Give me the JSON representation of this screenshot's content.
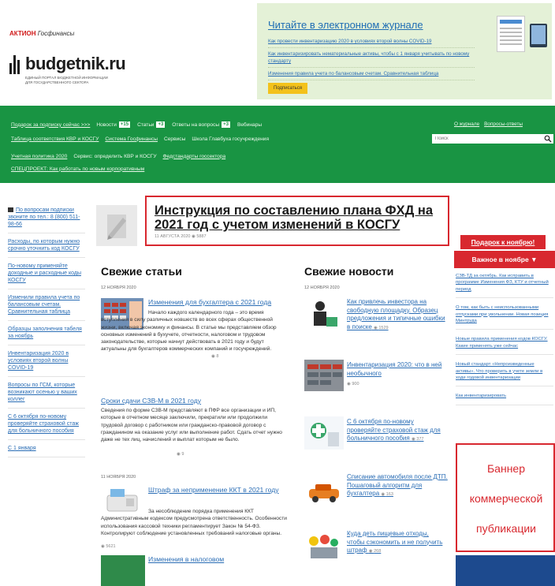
{
  "header": {
    "brand_logo": "АКТИОН",
    "brand_suffix": "Госфинансы",
    "site_name": "budgetnik.ru",
    "site_tagline": "Единый портал бюджетной информации для государственного сектора",
    "journal": {
      "title": "Читайте в электронном журнале",
      "items": [
        "Как провести инвентаризацию 2020 в условиях второй волны COVID-19",
        "Как инвентаризировать нематериальные активы, чтобы с 1 января учитывать по новому стандарту",
        "Изменения правила учета по балансовым счетам. Сравнительная таблица"
      ],
      "subscribe_label": "Подписаться"
    }
  },
  "nav": {
    "row1": [
      {
        "label": "Подарок за подписку сейчас >>>",
        "link": true
      },
      {
        "label": "Новости",
        "link": false,
        "badge": "+15"
      },
      {
        "label": "Статьи",
        "link": false,
        "badge": "+3"
      },
      {
        "label": "Ответы на вопросы",
        "link": false,
        "badge": "+3"
      },
      {
        "label": "Вебинары",
        "link": false
      }
    ],
    "row2": [
      {
        "label": "Таблица соответствия КВР и КОСГУ",
        "link": true
      },
      {
        "label": "Система Госфинансы",
        "link": true
      },
      {
        "label": "Сервисы",
        "link": false
      },
      {
        "label": "Школа Главбуха госучреждения",
        "link": false
      }
    ],
    "row3": [
      {
        "label": "Учетная политика 2020",
        "link": true
      },
      {
        "label": "Сервис: определить КВР и КОСГУ",
        "link": false
      },
      {
        "label": "Федстандарты госсектора",
        "link": true
      }
    ],
    "row4": [
      {
        "label": "СПЕЦПРОЕКТ: Как работать по новым корпоративным",
        "link": true
      }
    ],
    "right_links": [
      "О журнале",
      "Вопросы-ответы"
    ],
    "search_placeholder": "Поиск"
  },
  "left_sidebar": {
    "phone_block": "По вопросам подписки звоните по тел.: 8 (800) 511-98-66",
    "items": [
      "Расходы, по которым нужно срочно уточнить код КОСГУ",
      "По-новому применяйте доходные и расходные коды КОСГУ",
      "Изменили правила учета по балансовым счетам. Сравнительная таблица",
      "Образцы заполнения табеля за ноябрь",
      "Инвентаризация 2020 в условиях второй волны COVID-19",
      "Вопросы по ГСМ, которые возникают осенью у ваших коллег",
      "С 6 октября по-новому проверяйте страховой стаж для больничного пособия",
      "С 1 января"
    ]
  },
  "hero": {
    "title": "Инструкция по составлению плана ФХД на 2021 год с учетом изменений в КОСГУ",
    "date": "11 АВГУСТА 2020",
    "views": "5887"
  },
  "articles": {
    "heading": "Свежие статьи",
    "date1": "12 ноября 2020",
    "a1": {
      "title": "Изменения для бухгалтера с 2021 года",
      "text": "Начало каждого календарного года – это время вступления в силу различных новшеств во всех сферах общественной жизни, включая экономику и финансы. В статье мы представляем обзор основных изменений в бухучете, отчетности, налоговом и трудовом законодательстве, которые начнут действовать в 2021 году и будут актуальны для бухгалтеров коммерческих компаний и госучреждений.",
      "views": "8"
    },
    "a2": {
      "title": "Сроки сдачи СЗВ-М в 2021 году",
      "text": "Сведения по форме СЗВ-М представляют в ПФР все организации и ИП, которые в отчетном месяце заключили, прекратили или продолжили трудовой договор с работником или гражданско-правовой договор с гражданином на оказание услуг или выполнение работ. Сдать отчет нужно даже не тех лиц, начислений и выплат которым не было.",
      "views": "9"
    },
    "date2": "11 ноября 2020",
    "a3": {
      "title": "Штраф за неприменение ККТ в 2021 году",
      "text": "За несоблюдение порядка применения ККТ Административным кодексом предусмотрена ответственность. Особенности использования кассовой техники регламентирует Закон № 54-ФЗ. Контролируют соблюдение установленных требований налоговые органы.",
      "views": "5621"
    },
    "a4": {
      "title": "Изменения в налоговом"
    }
  },
  "news": {
    "heading": "Свежие новости",
    "date": "12 ноября 2020",
    "items": [
      {
        "title": "Как привлечь инвестора на свободную площадку. Образец предложения и типичные ошибки в поиске",
        "views": "1529"
      },
      {
        "title": "Инвентаризация 2020: что в ней необычного",
        "views": "900"
      },
      {
        "title": "С 6 октября по-новому проверяйте страховой стаж для больничного пособия",
        "views": "377"
      },
      {
        "title": "Списание автомобиля после ДТП. Пошаговый алгоритм для бухгалтера",
        "views": "163"
      },
      {
        "title": "Куда деть пищевые отходы, чтобы сэкономить и не получить штраф",
        "views": "268"
      }
    ]
  },
  "right_sidebar": {
    "gift": "Подарок к ноябрю!",
    "important": "Важное в ноябре ▼",
    "items": [
      "СЗВ-ТД за октябрь. Как исправить в программе Изменения ФЗ, КТУ и отчетный период",
      "О том, как быть с неиспользованными отпусками при увольнении. Новая позиция Минтруда",
      "Новые правила применения кодов КОСГУ. Какие применять уже сейчас",
      "Новый стандарт «Непроизведенные активы». Что проверить в учете земли в ходе годовой инвентаризации",
      "Как инвентаризировать"
    ],
    "banner_lines": [
      "Баннер",
      "коммерческой",
      "публикации"
    ]
  },
  "colors": {
    "nav_green": "#199443",
    "accent_red": "#d8282f",
    "link_blue": "#2a6db5",
    "journal_bg": "#e4f1d7",
    "button_yellow": "#f3c21b"
  }
}
